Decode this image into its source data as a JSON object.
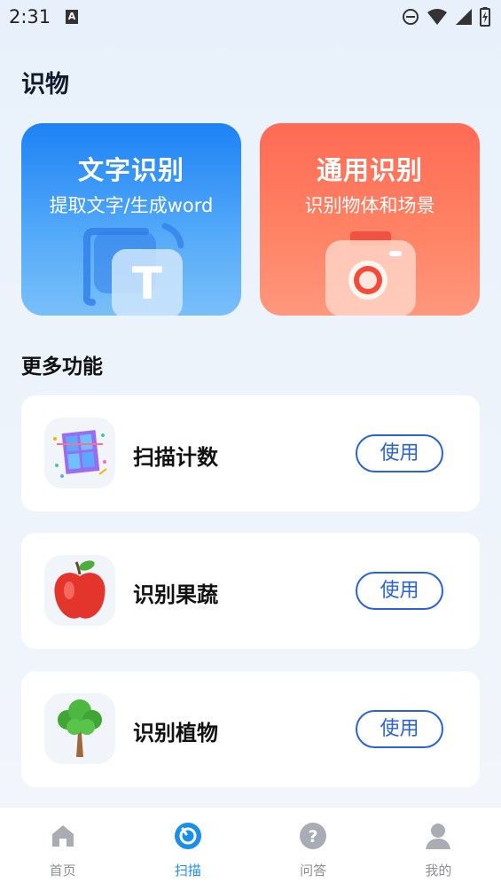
{
  "status_bar": {
    "time": "2:31",
    "notif_icon_letter": "A"
  },
  "page_title": "识物",
  "big_cards": [
    {
      "title": "文字识别",
      "subtitle": "提取文字/生成word",
      "icon": "text-recognition-icon",
      "icon_letter": "T",
      "color": "#1d82f5"
    },
    {
      "title": "通用识别",
      "subtitle": "识别物体和场景",
      "icon": "camera-icon",
      "color": "#ff6a55"
    }
  ],
  "section_title": "更多功能",
  "features": [
    {
      "name": "扫描计数",
      "button": "使用",
      "icon": "scan-count-icon"
    },
    {
      "name": "识别果蔬",
      "button": "使用",
      "icon": "apple-icon"
    },
    {
      "name": "识别植物",
      "button": "使用",
      "icon": "tree-icon"
    }
  ],
  "bottom_nav": [
    {
      "label": "首页",
      "icon": "home-icon",
      "active": false
    },
    {
      "label": "扫描",
      "icon": "scan-icon",
      "active": true
    },
    {
      "label": "问答",
      "icon": "question-icon",
      "active": false
    },
    {
      "label": "我的",
      "icon": "profile-icon",
      "active": false
    }
  ],
  "colors": {
    "accent": "#1b8ee8",
    "button_border": "#2a62d8",
    "nav_inactive": "#8c8f95"
  }
}
